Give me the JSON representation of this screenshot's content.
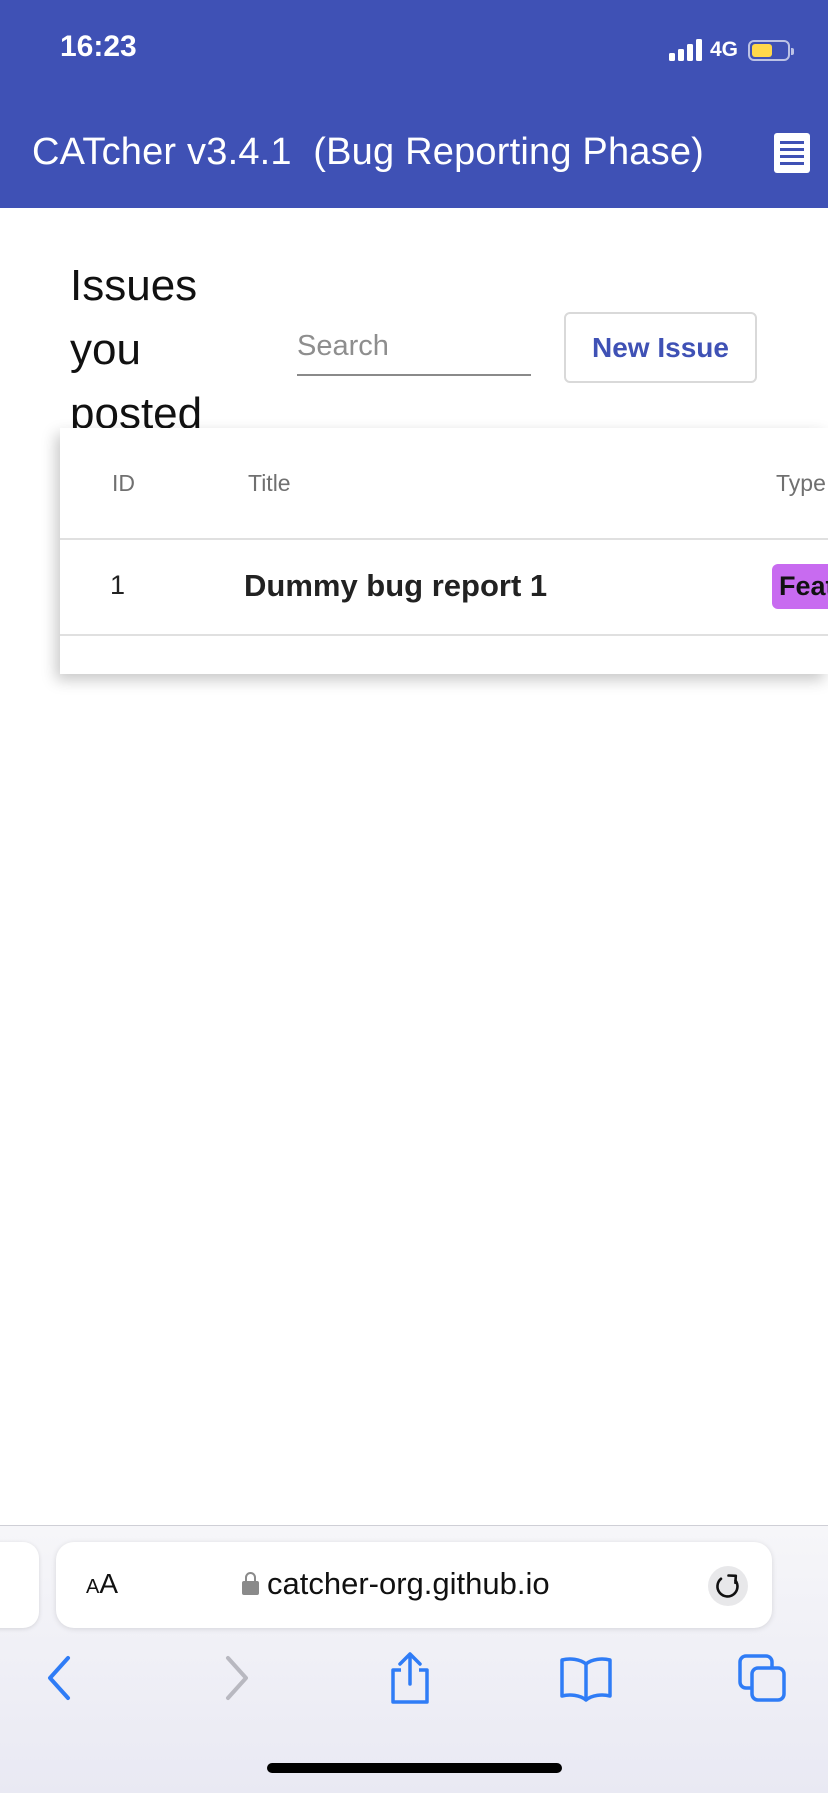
{
  "status_bar": {
    "time": "16:23",
    "network": "4G",
    "battery_level": 0.5,
    "battery_color": "#ffd84a"
  },
  "header": {
    "title": "CATcher v3.4.1  (Bug Reporting Phase)",
    "background_color": "#3f51b5",
    "menu_icon": "receipt-menu-icon"
  },
  "main": {
    "heading": "Issues you posted",
    "search": {
      "placeholder": "Search",
      "value": ""
    },
    "new_issue_label": "New Issue"
  },
  "table": {
    "columns": [
      "ID",
      "Title",
      "Type"
    ],
    "rows": [
      {
        "id": "1",
        "title": "Dummy bug report 1",
        "type": "Feat",
        "type_color": "#c86bf0"
      }
    ]
  },
  "browser": {
    "text_size_small": "A",
    "text_size_large": "A",
    "url": "catcher-org.github.io",
    "icons": [
      "lock-icon",
      "reload-icon",
      "back-icon",
      "forward-icon",
      "share-icon",
      "bookmarks-icon",
      "tabs-icon"
    ]
  }
}
